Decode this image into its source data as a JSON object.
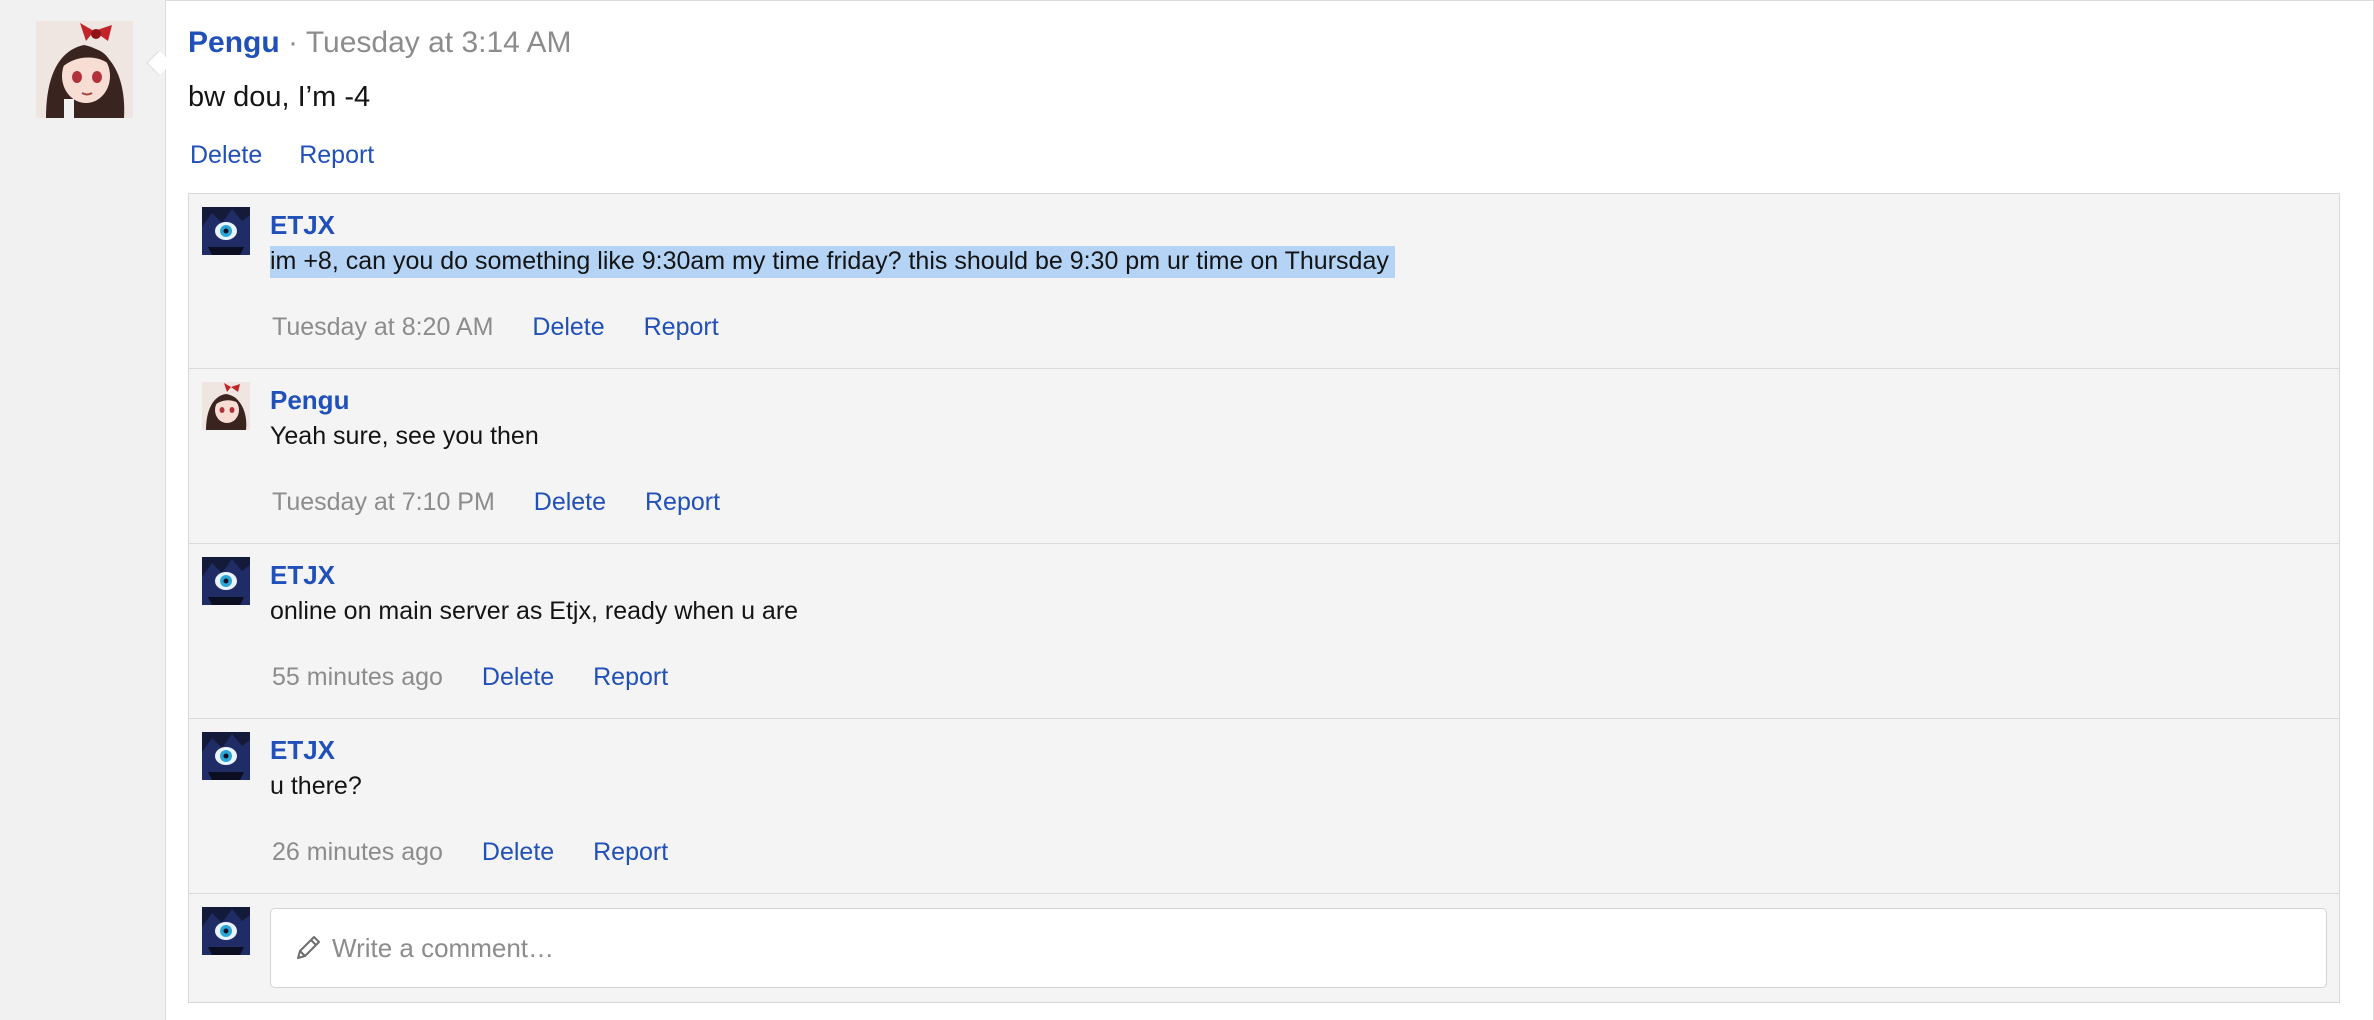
{
  "post": {
    "author": "Pengu",
    "separator": "·",
    "timestamp": "Tuesday at 3:14 AM",
    "body": "bw dou, I’m -4",
    "actions": {
      "delete": "Delete",
      "report": "Report"
    }
  },
  "comments": [
    {
      "author": "ETJX",
      "avatar": "etjx-avatar",
      "body": "im +8, can you do something like 9:30am my time friday? this should be 9:30 pm ur time on Thursday",
      "selected": true,
      "timestamp": "Tuesday at 8:20 AM",
      "delete": "Delete",
      "report": "Report"
    },
    {
      "author": "Pengu",
      "avatar": "pengu-avatar",
      "body": "Yeah sure, see you then",
      "selected": false,
      "timestamp": "Tuesday at 7:10 PM",
      "delete": "Delete",
      "report": "Report"
    },
    {
      "author": "ETJX",
      "avatar": "etjx-avatar",
      "body": "online on main server as Etjx, ready when u are",
      "selected": false,
      "timestamp": "55 minutes ago",
      "delete": "Delete",
      "report": "Report"
    },
    {
      "author": "ETJX",
      "avatar": "etjx-avatar",
      "body": "u there?",
      "selected": false,
      "timestamp": "26 minutes ago",
      "delete": "Delete",
      "report": "Report"
    }
  ],
  "composer": {
    "icon": "pencil-icon",
    "placeholder": "Write a comment…"
  },
  "colors": {
    "link": "#2150b8",
    "muted": "#8c8c8c",
    "comments_bg": "#f4f4f4",
    "selection": "#b4d3f5"
  }
}
